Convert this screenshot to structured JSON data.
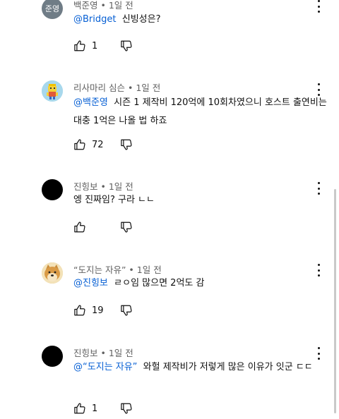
{
  "comments": [
    {
      "avatar_text": "준영",
      "author": "백준영",
      "time": "1일 전",
      "mention": "@Bridget",
      "text": "신빙성은?",
      "likes": "1"
    },
    {
      "author": "리사마리 심슨",
      "time": "1일 전",
      "mention": "@백준영",
      "text": "시즌 1 제작비 120억에 10회차였으니 호스트 출연비는 대충 1억은 나올 법 하죠",
      "likes": "72"
    },
    {
      "author": "진힝보",
      "time": "1일 전",
      "mention": "",
      "text": "엥 진짜임? 구라 ㄴㄴ",
      "likes": ""
    },
    {
      "author": "“도지는 자유”",
      "time": "1일 전",
      "mention": "@진힝보",
      "text": "ㄹㅇ임 많으면 2억도 감",
      "likes": "19"
    },
    {
      "author": "진힝보",
      "time": "1일 전",
      "mention": "@“도지는 자유”",
      "text": "와헐 제작비가 저렇게 많은 이유가 잇군 ㄷㄷ",
      "likes": "1"
    }
  ],
  "separator": " • ",
  "icons": {
    "like": "thumbs-up-icon",
    "dislike": "thumbs-down-icon",
    "more": "more-vert-icon"
  },
  "colors": {
    "mention": "#065fd4",
    "meta": "#606060"
  }
}
